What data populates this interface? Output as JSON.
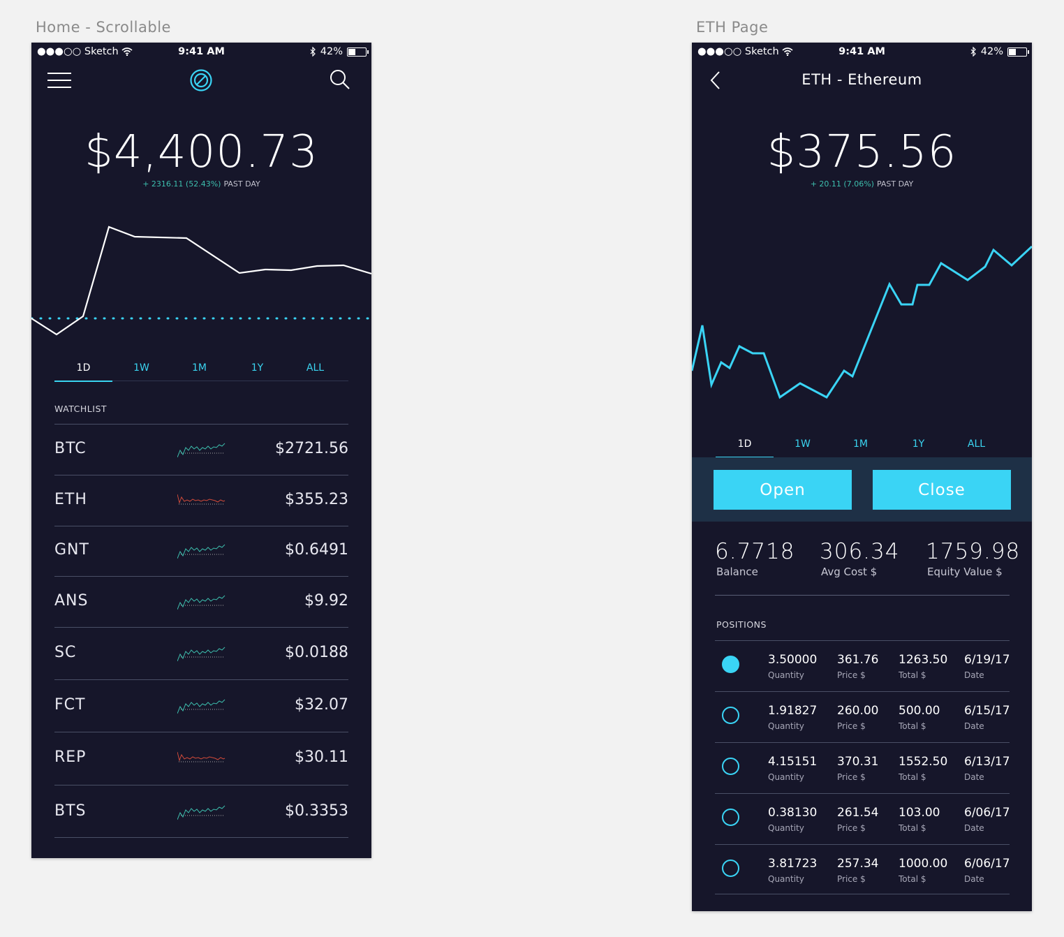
{
  "artboards": {
    "home_label": "Home - Scrollable",
    "eth_label": "ETH Page"
  },
  "status_bar": {
    "carrier": "●●●○○ Sketch",
    "time": "9:41 AM",
    "battery": "42%"
  },
  "home": {
    "portfolio_value": "$4,400.73",
    "change": "+ 2316.11 (52.43%)",
    "change_period": "PAST DAY",
    "tabs": [
      "1D",
      "1W",
      "1M",
      "1Y",
      "ALL"
    ],
    "active_tab": "1D",
    "watchlist_label": "WATCHLIST",
    "watchlist": [
      {
        "symbol": "BTC",
        "price": "$2721.56",
        "trend": "up"
      },
      {
        "symbol": "ETH",
        "price": "$355.23",
        "trend": "down"
      },
      {
        "symbol": "GNT",
        "price": "$0.6491",
        "trend": "up"
      },
      {
        "symbol": "ANS",
        "price": "$9.92",
        "trend": "up"
      },
      {
        "symbol": "SC",
        "price": "$0.0188",
        "trend": "up"
      },
      {
        "symbol": "FCT",
        "price": "$32.07",
        "trend": "up"
      },
      {
        "symbol": "REP",
        "price": "$30.11",
        "trend": "down"
      },
      {
        "symbol": "BTS",
        "price": "$0.3353",
        "trend": "up"
      }
    ]
  },
  "eth": {
    "title": "ETH - Ethereum",
    "price": "$375.56",
    "change": "+ 20.11 (7.06%)",
    "change_period": "PAST DAY",
    "tabs": [
      "1D",
      "1W",
      "1M",
      "1Y",
      "ALL"
    ],
    "active_tab": "1D",
    "open_label": "Open",
    "close_label": "Close",
    "stats": [
      {
        "value": "6.7718",
        "label": "Balance"
      },
      {
        "value": "306.34",
        "label": "Avg Cost $"
      },
      {
        "value": "1759.98",
        "label": "Equity Value $"
      }
    ],
    "positions_label": "POSITIONS",
    "position_labels": {
      "quantity": "Quantity",
      "price": "Price $",
      "total": "Total $",
      "date": "Date"
    },
    "positions": [
      {
        "quantity": "3.50000",
        "price": "361.76",
        "total": "1263.50",
        "date": "6/19/17",
        "selected": true
      },
      {
        "quantity": "1.91827",
        "price": "260.00",
        "total": "500.00",
        "date": "6/15/17",
        "selected": false
      },
      {
        "quantity": "4.15151",
        "price": "370.31",
        "total": "1552.50",
        "date": "6/13/17",
        "selected": false
      },
      {
        "quantity": "0.38130",
        "price": "261.54",
        "total": "103.00",
        "date": "6/06/17",
        "selected": false
      },
      {
        "quantity": "3.81723",
        "price": "257.34",
        "total": "1000.00",
        "date": "6/06/17",
        "selected": false
      }
    ]
  },
  "colors": {
    "background": "#16162a",
    "accent": "#3ad4f5",
    "positive": "#3dbfae",
    "negative": "#d04a3a",
    "action_bar": "#1e3046"
  },
  "icons": [
    "menu-icon",
    "compass-logo-icon",
    "search-icon",
    "back-chevron-icon",
    "wifi-icon",
    "bluetooth-icon",
    "battery-icon"
  ]
}
